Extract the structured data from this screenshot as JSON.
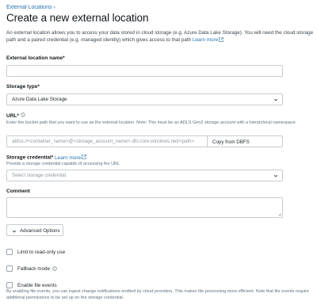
{
  "breadcrumb": {
    "label": "External Locations",
    "separator": "›"
  },
  "page": {
    "title": "Create a new external location",
    "description": "An external location allows you to access your data stored in cloud storage (e.g. Azure Data Lake Storage). You will need the cloud storage path and a paired credential (e.g. managed identity) which gives access to that path",
    "learn_more": "Learn more"
  },
  "form": {
    "name_field": {
      "label": "External location name*",
      "value": "",
      "placeholder": ""
    },
    "storage_type": {
      "label": "Storage type*",
      "selected": "Azure Data Lake Storage"
    },
    "url": {
      "label": "URL*",
      "hint": "Enter the bucket path that you want to use as the external location. Note: This must be an ADLS Gen2 storage account with a hierarchical namespace",
      "placeholder": "abfss://<container_name>@<storage_account_name>.dfs.core.windows.net/<path>",
      "copy_button": "Copy from DBFS"
    },
    "storage_credential": {
      "label": "Storage credential*",
      "learn_more": "Learn more",
      "hint": "Provide a storage credential capable of accessing the URL",
      "placeholder": "Select storage credential"
    },
    "comment": {
      "label": "Comment",
      "value": ""
    },
    "advanced_options": "Advanced Options",
    "read_only": {
      "label": "Limit to read-only use",
      "checked": false
    },
    "fallback_mode": {
      "label": "Fallback mode",
      "checked": false
    },
    "file_events": {
      "label": "Enable file events",
      "checked": false,
      "hint": "By enabling file events, you can ingest change notifications emitted by cloud providers. This makes file processing more efficient. Note that file events require additional permissions to be set up on the storage credential."
    }
  },
  "colors": {
    "link": "#2272b4",
    "border": "#c6cdd3",
    "text": "#1f272d",
    "muted": "#5f7281"
  }
}
